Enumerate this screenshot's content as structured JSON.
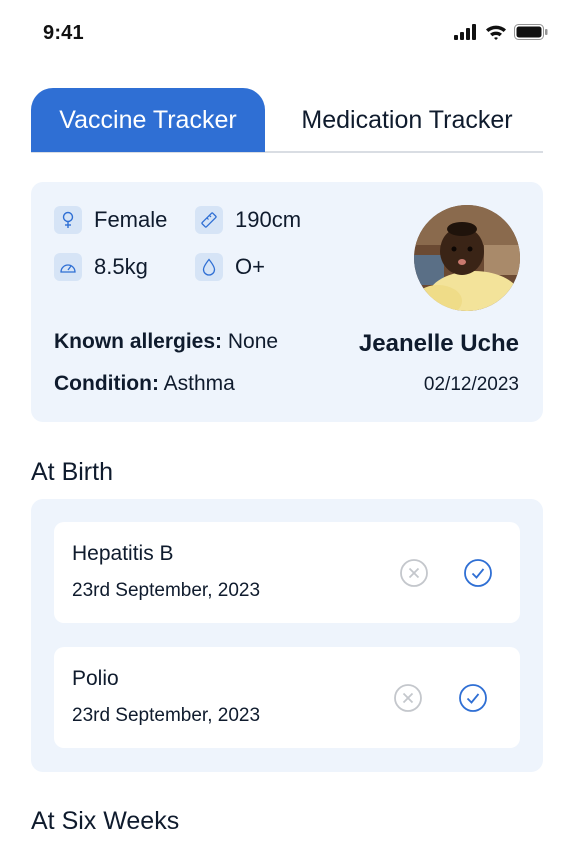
{
  "status_bar": {
    "time": "9:41",
    "icons": [
      "signal-icon",
      "wifi-icon",
      "battery-icon"
    ]
  },
  "tabs": [
    {
      "label": "Vaccine Tracker",
      "active": true
    },
    {
      "label": "Medication Tracker",
      "active": false
    }
  ],
  "profile": {
    "gender": {
      "icon": "female-icon",
      "value": "Female"
    },
    "height": {
      "icon": "ruler-icon",
      "value": "190cm"
    },
    "weight": {
      "icon": "scale-icon",
      "value": "8.5kg"
    },
    "blood_type": {
      "icon": "blood-drop-icon",
      "value": "O+"
    },
    "allergies_label": "Known allergies:",
    "allergies_value": "None",
    "condition_label": "Condition:",
    "condition_value": "Asthma",
    "name": "Jeanelle Uche",
    "date": "02/12/2023"
  },
  "sections": [
    {
      "title": "At Birth",
      "vaccines": [
        {
          "name": "Hepatitis B",
          "date": "23rd September, 2023"
        },
        {
          "name": "Polio",
          "date": "23rd September, 2023"
        }
      ]
    },
    {
      "title": "At Six Weeks",
      "vaccines": []
    }
  ],
  "colors": {
    "accent": "#2f6fd4",
    "card_bg": "#eef4fc",
    "text": "#0f1b2d",
    "muted_icon": "#c4c7cc"
  }
}
